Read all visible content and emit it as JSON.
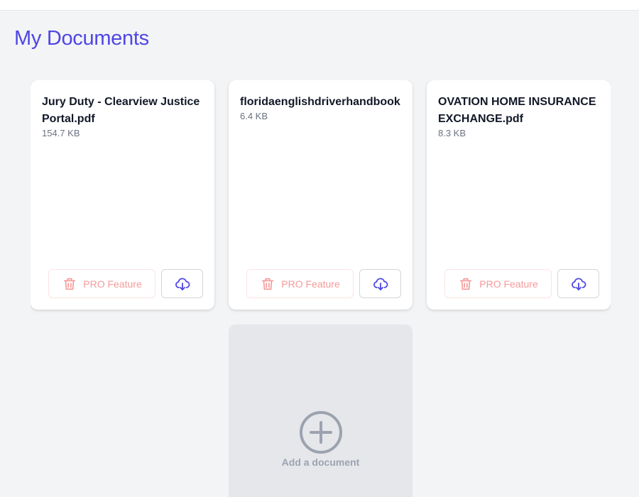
{
  "page": {
    "title": "My Documents"
  },
  "documents": [
    {
      "name": "Jury Duty - Clearview Justice Portal.pdf",
      "size": "154.7 KB"
    },
    {
      "name": "floridaenglishdriverhandbook",
      "size": "6.4 KB"
    },
    {
      "name": "OVATION HOME INSURANCE EXCHANGE.pdf",
      "size": "8.3 KB"
    }
  ],
  "actions": {
    "pro_label": "PRO Feature",
    "pro_icon": "trash-icon",
    "download_icon": "cloud-download-icon"
  },
  "add": {
    "label": "Add a document",
    "icon": "plus-circle-icon"
  },
  "colors": {
    "accent": "#4f46e5",
    "pro_text": "#f69a9a",
    "muted": "#9ca3af"
  }
}
